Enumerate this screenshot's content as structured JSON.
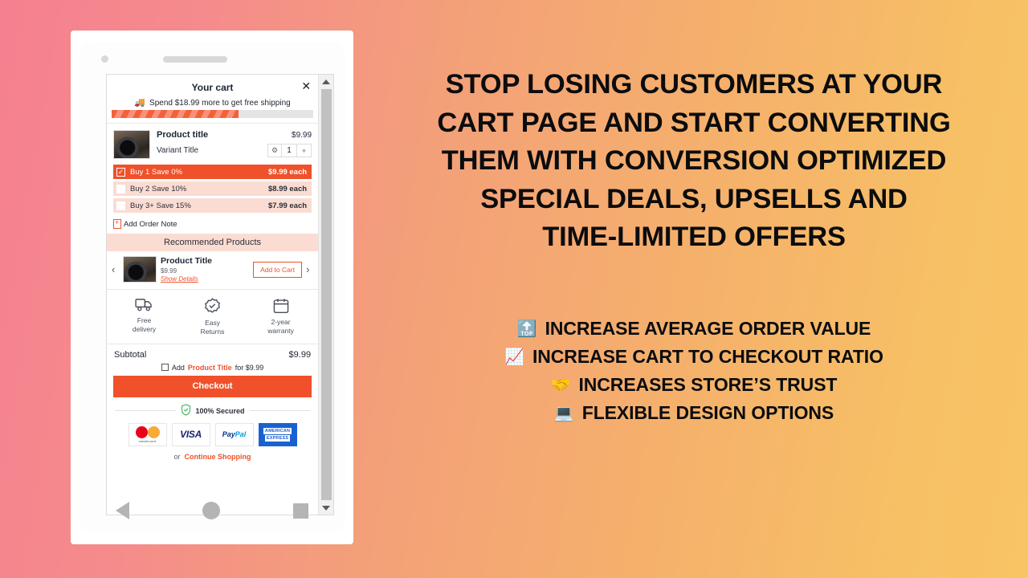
{
  "background": {
    "gradient_from": "#f5808f",
    "gradient_to": "#f8c464",
    "accent_orange": "#f0512a",
    "tier_bg": "#fbdcd2"
  },
  "phone": {
    "nav": {
      "back_label": "Back",
      "home_label": "Home",
      "recent_label": "Recent apps"
    }
  },
  "cart": {
    "title": "Your cart",
    "close_label": "✕",
    "shipping": {
      "truck_icon": "🚚",
      "message": "Spend $18.99 more to get free shipping",
      "progress_percent": 63
    },
    "line_item": {
      "title": "Product title",
      "price": "$9.99",
      "variant": "Variant Title",
      "qty_remove_icon": "⚙",
      "qty_value": "1",
      "qty_increase": "+"
    },
    "tiers": [
      {
        "label": "Buy 1 Save 0%",
        "price": "$9.99 each",
        "selected": true,
        "check": "✓"
      },
      {
        "label": "Buy 2 Save 10%",
        "price": "$8.99 each",
        "selected": false,
        "check": ""
      },
      {
        "label": "Buy 3+ Save 15%",
        "price": "$7.99 each",
        "selected": false,
        "check": ""
      }
    ],
    "add_note": "Add Order Note",
    "recommended": {
      "header": "Recommended Products",
      "prev_arrow": "‹",
      "next_arrow": "›",
      "product_title": "Product Title",
      "product_price": "$9.99",
      "show_details": "Show Details",
      "add_to_cart": "Add to Cart"
    },
    "badges": [
      {
        "line1": "Free",
        "line2": "delivery",
        "icon": "truck-icon"
      },
      {
        "line1": "Easy",
        "line2": "Returns",
        "icon": "check-seal-icon"
      },
      {
        "line1": "2-year",
        "line2": "warranty",
        "icon": "calendar-icon"
      }
    ],
    "subtotal": {
      "label": "Subtotal",
      "value": "$9.99"
    },
    "upsell": {
      "add": "Add",
      "product": "Product Title",
      "suffix": "for $9.99"
    },
    "checkout_label": "Checkout",
    "secured_text": "100% Secured",
    "payments": [
      {
        "name": "mastercard",
        "word": "mastercard"
      },
      {
        "name": "visa",
        "word": "VISA"
      },
      {
        "name": "paypal",
        "word_a": "Pay",
        "word_b": "Pal"
      },
      {
        "name": "american-express",
        "line1": "AMERICAN",
        "line2": "EXPRESS"
      }
    ],
    "continue": {
      "or": "or",
      "link": "Continue Shopping"
    }
  },
  "promo": {
    "headline_lines": [
      "STOP LOSING CUSTOMERS AT YOUR",
      "CART PAGE AND START CONVERTING",
      "THEM WITH CONVERSION OPTIMIZED",
      "SPECIAL DEALS, UPSELLS AND",
      "TIME-LIMITED OFFERS"
    ],
    "benefits": [
      {
        "icon": "🔝",
        "icon_name": "top-arrow-icon",
        "text": "INCREASE AVERAGE ORDER VALUE"
      },
      {
        "icon": "📈",
        "icon_name": "chart-increasing-icon",
        "text": "INCREASE CART TO CHECKOUT RATIO"
      },
      {
        "icon": "🤝",
        "icon_name": "handshake-icon",
        "text": "INCREASES STORE’S TRUST"
      },
      {
        "icon": "💻",
        "icon_name": "laptop-icon",
        "text": "FLEXIBLE DESIGN OPTIONS"
      }
    ]
  }
}
